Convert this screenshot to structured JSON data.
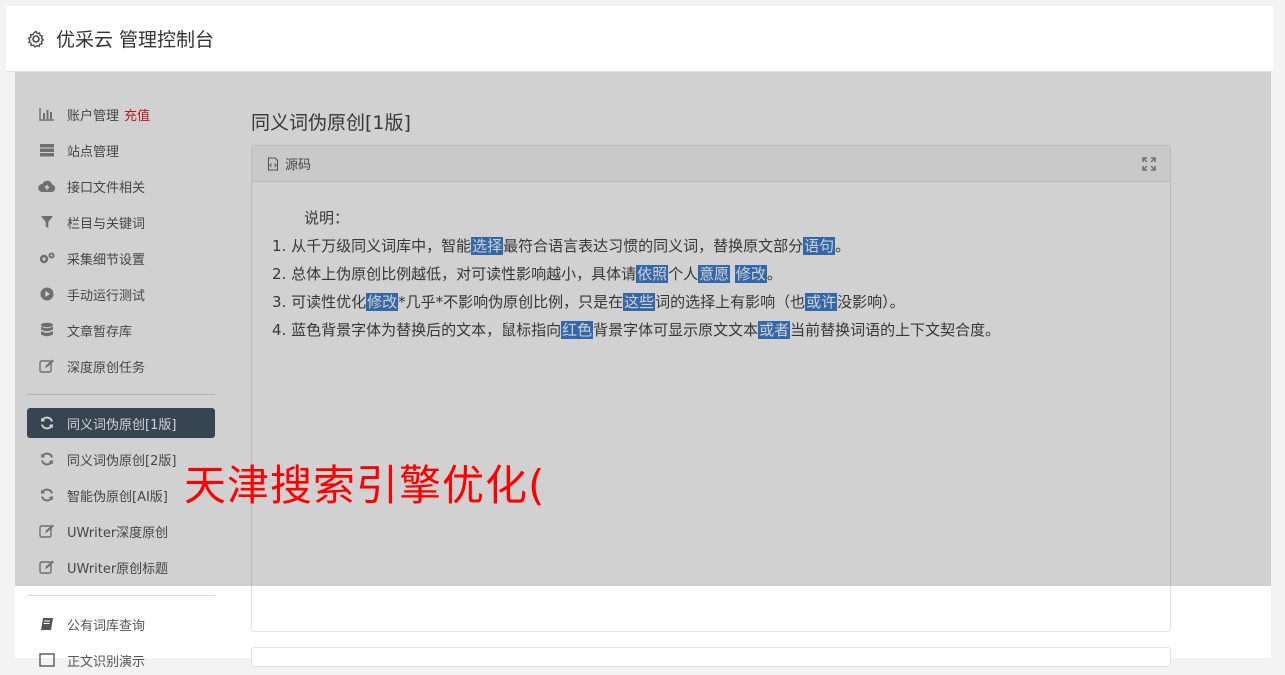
{
  "header": {
    "title": "优采云 管理控制台"
  },
  "sidebar": {
    "items": [
      {
        "label": "账户管理",
        "icon": "bar-chart-icon",
        "extra": "充值"
      },
      {
        "label": "站点管理",
        "icon": "server-icon"
      },
      {
        "label": "接口文件相关",
        "icon": "cloud-upload-icon"
      },
      {
        "label": "栏目与关键词",
        "icon": "filter-icon"
      },
      {
        "label": "采集细节设置",
        "icon": "gears-icon"
      },
      {
        "label": "手动运行测试",
        "icon": "play-circle-icon"
      },
      {
        "label": "文章暂存库",
        "icon": "database-icon"
      },
      {
        "label": "深度原创任务",
        "icon": "edit-icon"
      },
      {
        "label": "同义词伪原创[1版]",
        "icon": "refresh-icon"
      },
      {
        "label": "同义词伪原创[2版]",
        "icon": "refresh-icon"
      },
      {
        "label": "智能伪原创[AI版]",
        "icon": "refresh-icon"
      },
      {
        "label": "UWriter深度原创",
        "icon": "edit-icon"
      },
      {
        "label": "UWriter原创标题",
        "icon": "edit-icon"
      },
      {
        "label": "公有词库查询",
        "icon": "book-icon"
      },
      {
        "label": "正文识别演示",
        "icon": "square-icon"
      }
    ]
  },
  "main": {
    "title": "同义词伪原创[1版]",
    "panel": {
      "header": "源码",
      "note_heading": "说明：",
      "lines": [
        [
          {
            "t": "1. 从千万级同义词库中，智能"
          },
          {
            "t": "选择",
            "hl": true
          },
          {
            "t": "最符合语言表达习惯的同义词，替换原文部分"
          },
          {
            "t": "语句",
            "hl": true
          },
          {
            "t": "。"
          }
        ],
        [
          {
            "t": "2. 总体上伪原创比例越低，对可读性影响越小，具体请"
          },
          {
            "t": "依照",
            "hl": true
          },
          {
            "t": "个人"
          },
          {
            "t": "意愿",
            "hl": true
          },
          {
            "t": " "
          },
          {
            "t": "修改",
            "hl": true
          },
          {
            "t": "。"
          }
        ],
        [
          {
            "t": "3. 可读性优化"
          },
          {
            "t": "修改",
            "hl": true
          },
          {
            "t": "*几乎*不影响伪原创比例，只是在"
          },
          {
            "t": "这些",
            "hl": true
          },
          {
            "t": "词的选择上有影响（也"
          },
          {
            "t": "或许",
            "hl": true
          },
          {
            "t": "没影响）。"
          }
        ],
        [
          {
            "t": "4. 蓝色背景字体为替换后的文本，鼠标指向"
          },
          {
            "t": "红色",
            "hl": true
          },
          {
            "t": "背景字体可显示原文文本"
          },
          {
            "t": "或者",
            "hl": true
          },
          {
            "t": "当前替换词语的上下文契合度。"
          }
        ]
      ]
    }
  },
  "overlay_text": "天津搜索引擎优化(",
  "colors": {
    "accent": "#445566",
    "highlight": "#3d7fd1",
    "overlay_text": "#ff0000",
    "recharge": "#e02020"
  }
}
